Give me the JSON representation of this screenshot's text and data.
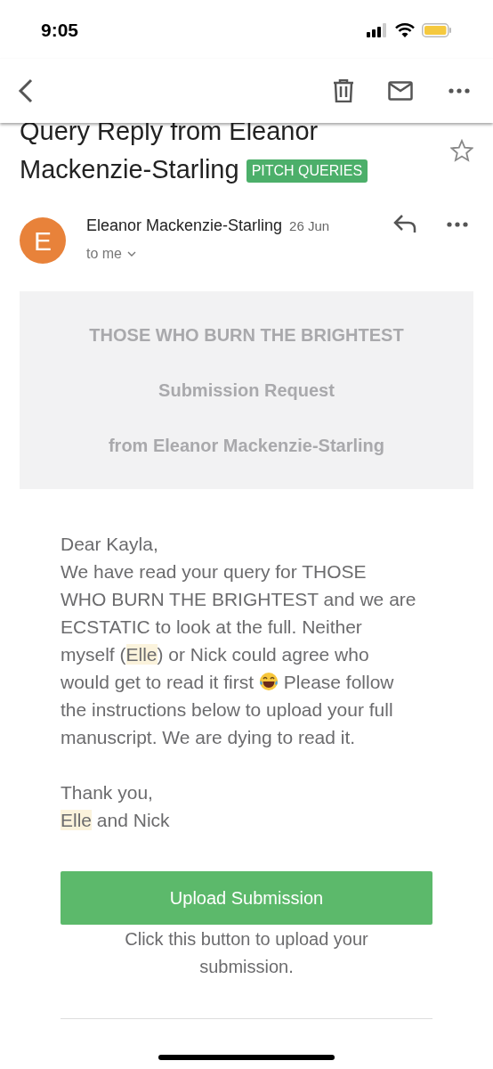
{
  "status_bar": {
    "time": "9:05"
  },
  "subject": {
    "lines": [
      "Query Reply from Eleanor",
      "Mackenzie-Starling"
    ],
    "label": "PITCH QUERIES",
    "starred": false
  },
  "message": {
    "sender_initial": "E",
    "sender": "Eleanor Mackenzie-Starling",
    "date": "26 Jun",
    "recipient": "to me"
  },
  "banner": {
    "lines": [
      "THOSE WHO BURN THE BRIGHTEST",
      "Submission Request",
      "from Eleanor Mackenzie-Starling"
    ]
  },
  "body": [
    [
      {
        "kind": "text",
        "text": "Dear Kayla,"
      }
    ],
    [
      {
        "kind": "text",
        "text": "We have read your query for THOSE WHO BURN THE BRIGHTEST and we are ECSTATIC to look at the full. Neither myself ("
      },
      {
        "kind": "highlight",
        "text": "Elle"
      },
      {
        "kind": "text",
        "text": ") or Nick could agree who would get to read it first "
      },
      {
        "kind": "emoji"
      },
      {
        "kind": "text",
        "text": " Please follow the instructions below to upload your full manuscript. We are dying to read it."
      }
    ],
    [
      {
        "kind": "text",
        "text": "Thank you,"
      }
    ],
    [
      {
        "kind": "highlight",
        "text": "Elle"
      },
      {
        "kind": "text",
        "text": " and Nick"
      }
    ]
  ],
  "upload_button": "Upload Submission",
  "caption": "Click this button to upload your submission."
}
